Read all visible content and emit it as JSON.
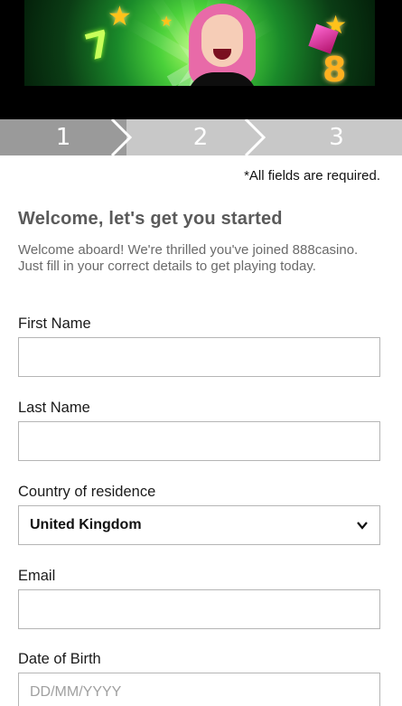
{
  "banner": {
    "alt_icons": [
      "star-icon",
      "slot-seven-icon",
      "slot-eight-icon",
      "gem-icon"
    ]
  },
  "steps": [
    {
      "label": "1",
      "state": "active"
    },
    {
      "label": "2",
      "state": "inactive"
    },
    {
      "label": "3",
      "state": "inactive"
    }
  ],
  "form": {
    "required_note": "*All fields are required.",
    "title": "Welcome, let's get you started",
    "intro": "Welcome aboard! We're thrilled you've joined 888casino. Just fill in your correct details to get playing today.",
    "first_name": {
      "label": "First Name",
      "value": "",
      "placeholder": ""
    },
    "last_name": {
      "label": "Last Name",
      "value": "",
      "placeholder": ""
    },
    "country": {
      "label": "Country of residence",
      "selected": "United Kingdom"
    },
    "email": {
      "label": "Email",
      "value": "",
      "placeholder": ""
    },
    "dob": {
      "label": "Date of Birth",
      "value": "",
      "placeholder": "DD/MM/YYYY"
    }
  },
  "colors": {
    "step_active": "#9a9a9a",
    "step_inactive": "#c8c8c8",
    "title": "#5a5a5a",
    "field_border": "#b5b5b5"
  }
}
